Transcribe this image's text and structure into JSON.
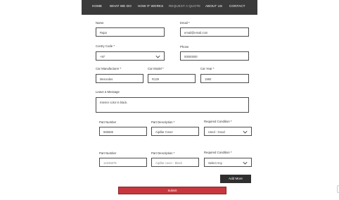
{
  "nav": {
    "items": [
      {
        "label": "HOME"
      },
      {
        "label": "WHAT WE DO"
      },
      {
        "label": "HOW IT WORKS"
      },
      {
        "label": "REQUEST A QUOTE"
      },
      {
        "label": "ABOUT US"
      },
      {
        "label": "CONTACT"
      }
    ],
    "active_index": 3
  },
  "form": {
    "name": {
      "label": "Name",
      "value": "Rajat"
    },
    "email": {
      "label": "Email *",
      "value": "email@email.com"
    },
    "country_code": {
      "label": "Contry Code *",
      "value": "+97"
    },
    "phone": {
      "label": "Phone",
      "value": "00000000"
    },
    "car_manufacturer": {
      "label": "Car Manufacturer *",
      "value": "Mercedes"
    },
    "car_model": {
      "label": "Car Model *",
      "value": "R129"
    },
    "car_year": {
      "label": "Car Year *",
      "value": "1990"
    },
    "message": {
      "label": "Leave a Message",
      "value": "Interior color is black."
    },
    "parts": [
      {
        "part_number_label": "Part Number",
        "part_number": "565565",
        "part_description_label": "Part Description *",
        "part_description": "Aipillar Cover",
        "condition_label": "Required Condition *",
        "condition": "Used - Good"
      },
      {
        "part_number_label": "Part Number",
        "part_number": "12345678",
        "part_description_label": "Part Description *",
        "part_description": "Aipillar cover - Black",
        "condition_label": "Required Condition *",
        "condition": "Select Any"
      }
    ],
    "add_more_label": "Add More",
    "submit_label": "Submit"
  },
  "colors": {
    "nav_bg": "#3a3a3a",
    "submit_bg": "#c8373f",
    "dark_button": "#2f2f2f"
  }
}
